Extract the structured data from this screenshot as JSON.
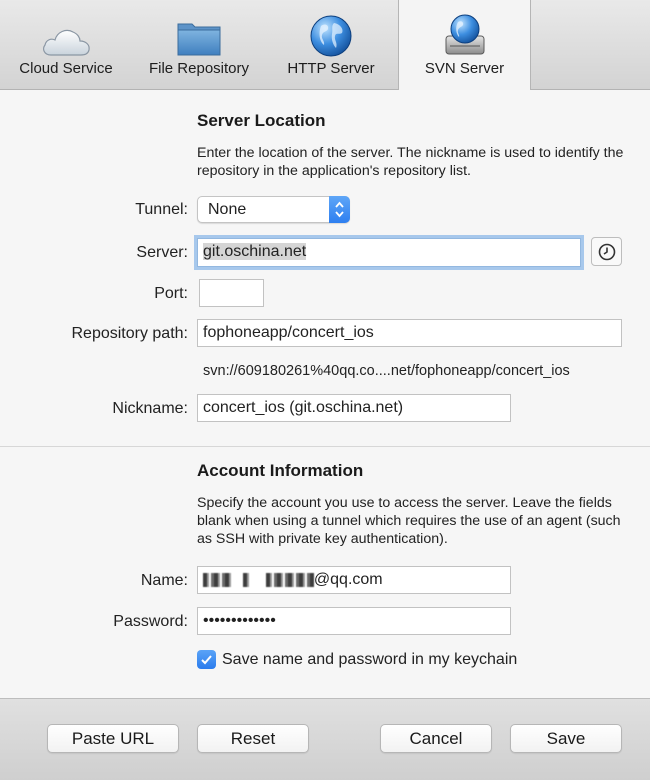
{
  "toolbar": {
    "tabs": [
      {
        "label": "Cloud Service",
        "icon": "cloud-icon"
      },
      {
        "label": "File Repository",
        "icon": "folder-icon"
      },
      {
        "label": "HTTP Server",
        "icon": "globe-icon"
      },
      {
        "label": "SVN Server",
        "icon": "server-globe-icon",
        "active": true
      }
    ]
  },
  "server_location": {
    "heading": "Server Location",
    "description": "Enter the location of the server. The nickname is used to identify the repository in the application's repository list.",
    "tunnel_label": "Tunnel:",
    "tunnel_value": "None",
    "server_label": "Server:",
    "server_value": "git.oschina.net",
    "port_label": "Port:",
    "port_value": "",
    "repo_path_label": "Repository path:",
    "repo_path_value": "fophoneapp/concert_ios",
    "resolved_url": "svn://609180261%40qq.co....net/fophoneapp/concert_ios",
    "nickname_label": "Nickname:",
    "nickname_value": "concert_ios (git.oschina.net)"
  },
  "account_information": {
    "heading": "Account Information",
    "description": "Specify the account you use to access the server. Leave the fields blank when using a tunnel which requires the use of an agent (such as SSH with private key authentication).",
    "name_label": "Name:",
    "name_value_visible": "@qq.com",
    "password_label": "Password:",
    "password_value": "•••••••••••••",
    "save_keychain_label": "Save name and password in my keychain",
    "save_keychain_checked": true
  },
  "buttons": {
    "paste_url": "Paste URL",
    "reset": "Reset",
    "cancel": "Cancel",
    "save": "Save"
  },
  "colors": {
    "accent": "#2d7ff0",
    "focus_ring": "#a7c8ec"
  }
}
